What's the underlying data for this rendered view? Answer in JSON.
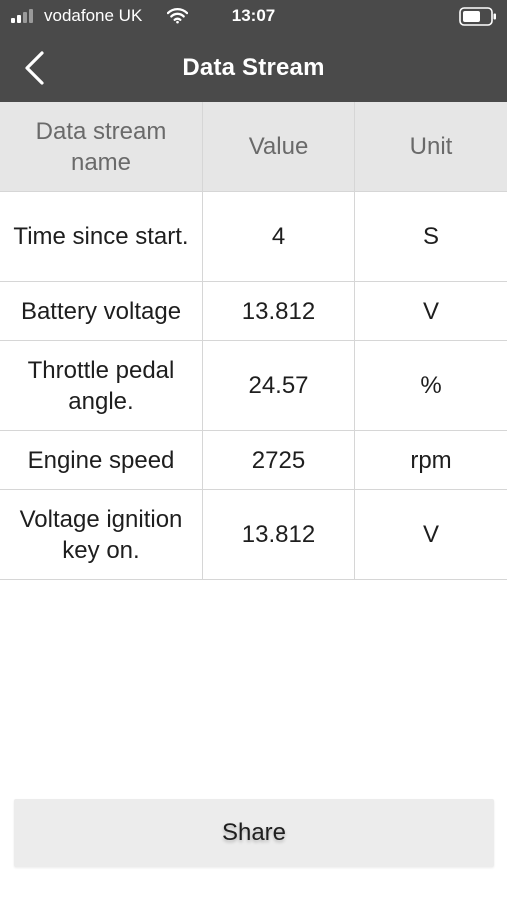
{
  "status_bar": {
    "carrier": "vodafone UK",
    "time": "13:07",
    "signal_icon": "signal-icon",
    "wifi_icon": "wifi-icon",
    "battery_icon": "battery-icon"
  },
  "nav": {
    "title": "Data Stream",
    "back_icon": "chevron-left-icon"
  },
  "table": {
    "headers": [
      "Data stream name",
      "Value",
      "Unit"
    ],
    "rows": [
      {
        "name": "Time since start.",
        "value": "4",
        "unit": "S"
      },
      {
        "name": "Battery voltage",
        "value": "13.812",
        "unit": "V"
      },
      {
        "name": "Throttle pedal angle.",
        "value": "24.57",
        "unit": "%"
      },
      {
        "name": "Engine speed",
        "value": "2725",
        "unit": "rpm"
      },
      {
        "name": "Voltage ignition key on.",
        "value": "13.812",
        "unit": "V"
      }
    ]
  },
  "share_button": {
    "label": "Share"
  },
  "colors": {
    "header_bg": "#4a4a4a",
    "table_header_bg": "#e6e6e6",
    "button_bg": "#ececec",
    "divider": "#d6d6d6"
  }
}
